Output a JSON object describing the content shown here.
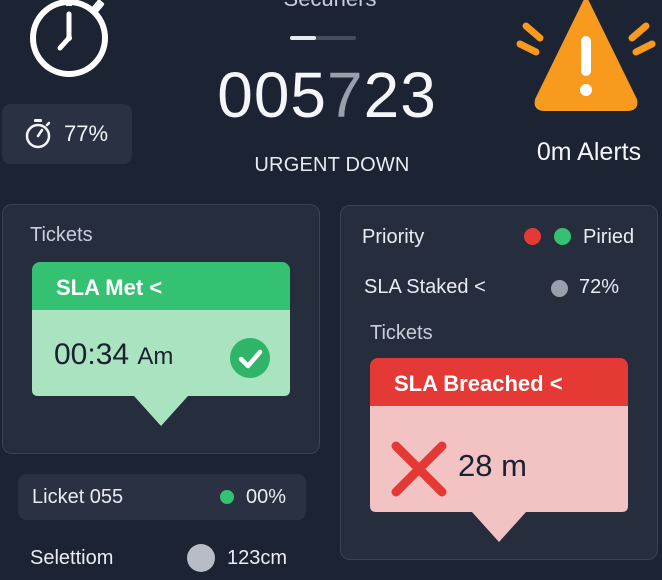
{
  "top": {
    "title": "Secuners",
    "progress": 0.4,
    "percent_chip": "77%",
    "counter": {
      "lead": "005",
      "dim": "7",
      "tail": "23"
    },
    "status": "URGENT DOWN",
    "alerts": "0m Alerts"
  },
  "tickets_panel": {
    "label": "Tickets",
    "sla_met": {
      "title": "SLA Met",
      "chevron": "<",
      "time": "00:34",
      "unit": "Am"
    },
    "licket_row": {
      "label": "Licket 055",
      "value": "00%"
    },
    "selection_row": {
      "label": "Selettiom",
      "value": "123cm"
    }
  },
  "priority_panel": {
    "label": "Priority",
    "status_text": "Piried",
    "sla_staked": {
      "label": "SLA Staked",
      "chevron": "<",
      "value": "72%"
    },
    "tickets_label": "Tickets",
    "sla_breached": {
      "title": "SLA Breached",
      "chevron": "<",
      "value": "28 m"
    }
  },
  "colors": {
    "background": "#1c2333",
    "panel": "#262d3d",
    "green": "#34c272",
    "green_body": "#a9e3c0",
    "red": "#e53935",
    "red_body": "#f3c3c3",
    "warning": "#f79a1e"
  },
  "icons": [
    "stopwatch-icon",
    "timer-icon",
    "warning-icon",
    "check-icon",
    "x-icon",
    "chevron-left-icon"
  ]
}
